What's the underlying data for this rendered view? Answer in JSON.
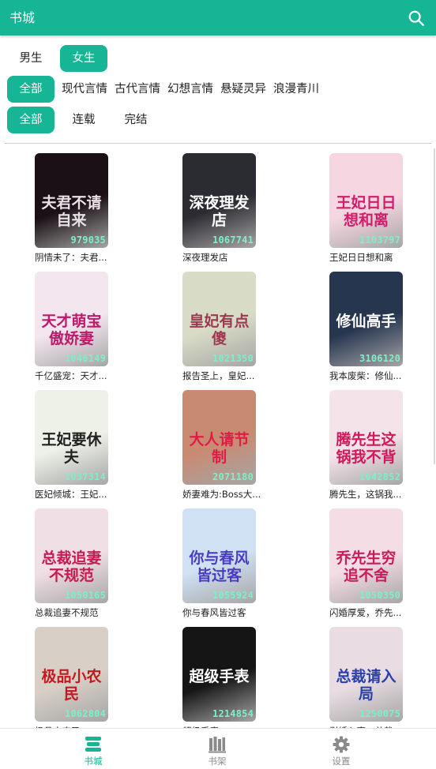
{
  "header": {
    "title": "书城",
    "search_icon": "search-icon"
  },
  "filters": {
    "gender": [
      {
        "label": "男生",
        "active": false
      },
      {
        "label": "女生",
        "active": true
      }
    ],
    "category": [
      {
        "label": "全部",
        "active": true
      },
      {
        "label": "现代言情",
        "active": false
      },
      {
        "label": "古代言情",
        "active": false
      },
      {
        "label": "幻想言情",
        "active": false
      },
      {
        "label": "悬疑灵异",
        "active": false
      },
      {
        "label": "浪漫青川",
        "active": false
      }
    ],
    "status": [
      {
        "label": "全部",
        "active": true
      },
      {
        "label": "连载",
        "active": false
      },
      {
        "label": "完结",
        "active": false
      }
    ]
  },
  "books": [
    {
      "name": "阴情未了：夫君...",
      "cover_text": "夫君不请自来",
      "count": "979035",
      "bg": "#1a1015",
      "fg": "#e8e0e8"
    },
    {
      "name": "深夜理发店",
      "cover_text": "深夜理发店",
      "count": "1067741",
      "bg": "#2b2b32",
      "fg": "#ffffff"
    },
    {
      "name": "王妃日日想和离",
      "cover_text": "王妃日日想和离",
      "count": "1103797",
      "bg": "#f6d7e1",
      "fg": "#d11d6b"
    },
    {
      "name": "千亿盛宠：天才...",
      "cover_text": "天才萌宝傲娇妻",
      "count": "1046149",
      "bg": "#f3e6ef",
      "fg": "#c0186a"
    },
    {
      "name": "报告圣上，皇妃...",
      "cover_text": "皇妃有点傻",
      "count": "1021350",
      "bg": "#d8dcc6",
      "fg": "#9b3a52"
    },
    {
      "name": "我本废柴：修仙...",
      "cover_text": "修仙高手",
      "count": "3106120",
      "bg": "#27364f",
      "fg": "#ffffff"
    },
    {
      "name": "医妃倾城：王妃...",
      "cover_text": "王妃要休夫",
      "count": "1037314",
      "bg": "#eef1e8",
      "fg": "#222222"
    },
    {
      "name": "娇妻难为:Boss大...",
      "cover_text": "大人请节制",
      "count": "2071180",
      "bg": "#c98a72",
      "fg": "#e01c45"
    },
    {
      "name": "腾先生，这锅我...",
      "cover_text": "腾先生这锅我不背",
      "count": "1042852",
      "bg": "#f4e4ea",
      "fg": "#d2175c"
    },
    {
      "name": "总裁追妻不规范",
      "cover_text": "总裁追妻不规范",
      "count": "1050165",
      "bg": "#f0dfe4",
      "fg": "#c81a52"
    },
    {
      "name": "你与春风皆过客",
      "cover_text": "你与春风皆过客",
      "count": "1055924",
      "bg": "#cfe1f3",
      "fg": "#4a3cc0"
    },
    {
      "name": "闪婚厚爱，乔先...",
      "cover_text": "乔先生穷追不舍",
      "count": "1050350",
      "bg": "#f5dde5",
      "fg": "#c81c5a"
    },
    {
      "name": "极品小农民",
      "cover_text": "极品小农民",
      "count": "1062804",
      "bg": "#d8d0c6",
      "fg": "#c21a20"
    },
    {
      "name": "超级手表",
      "cover_text": "超级手表",
      "count": "1214854",
      "bg": "#151515",
      "fg": "#ffffff"
    },
    {
      "name": "引婚入室：总裁...",
      "cover_text": "总裁请入局",
      "count": "1250075",
      "bg": "#e9dde3",
      "fg": "#2a3fa8"
    }
  ],
  "bottom_nav": [
    {
      "label": "书城",
      "icon": "bookstore-icon",
      "active": true
    },
    {
      "label": "书架",
      "icon": "bookshelf-icon",
      "active": false
    },
    {
      "label": "设置",
      "icon": "settings-gear-icon",
      "active": false
    }
  ],
  "colors": {
    "accent": "#15b596",
    "inactive": "#8a8a8a"
  }
}
